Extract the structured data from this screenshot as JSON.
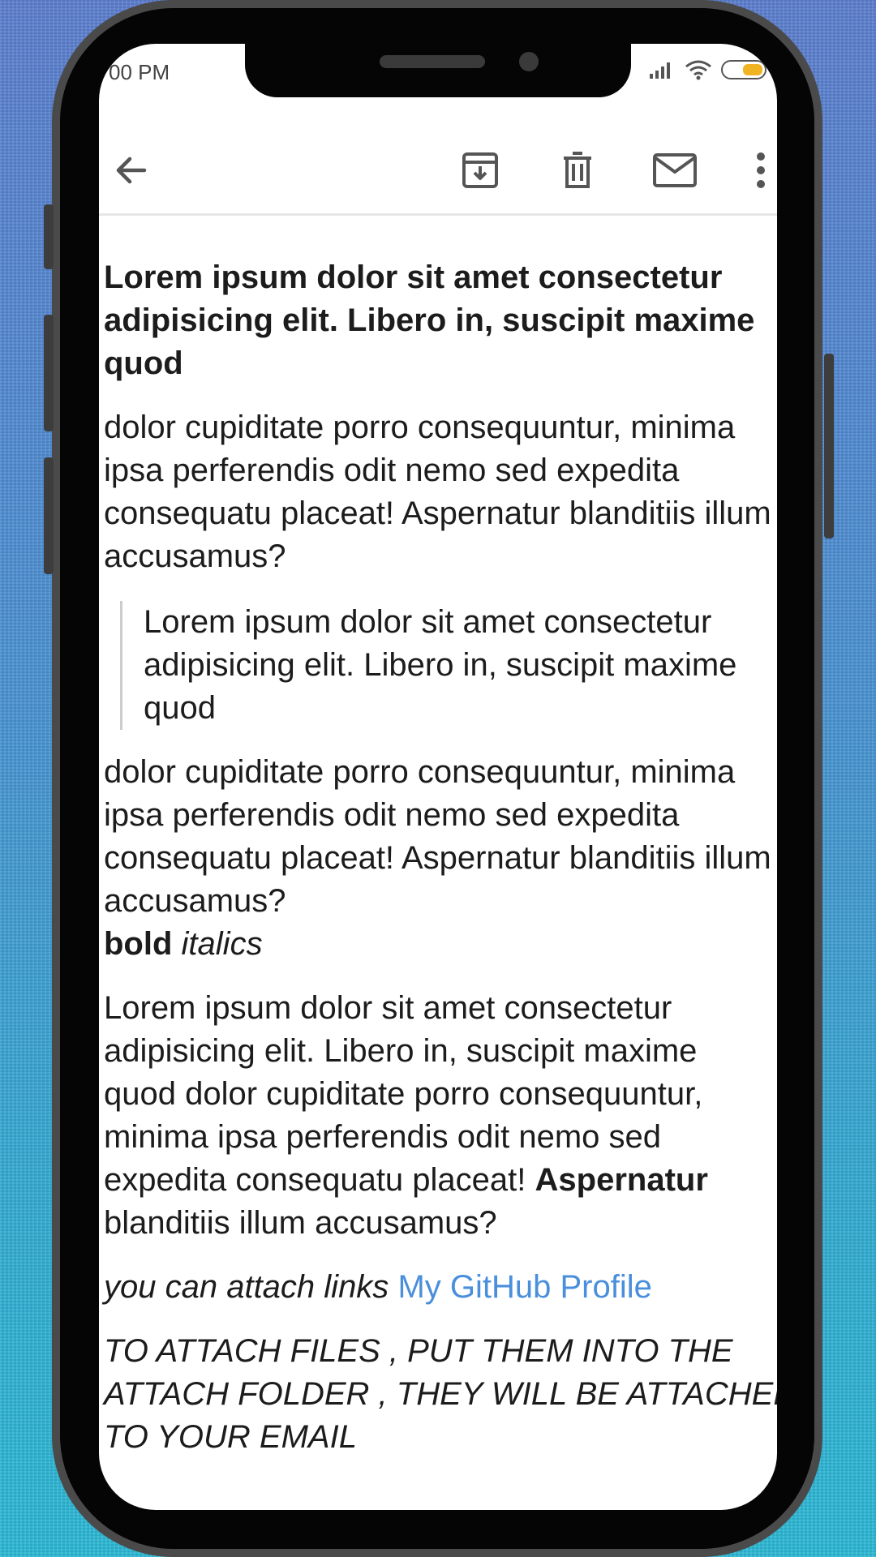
{
  "status_bar": {
    "time": "00 PM",
    "battery_percent": "4"
  },
  "toolbar": {
    "back_icon": "arrow-left-icon",
    "archive_icon": "archive-icon",
    "delete_icon": "trash-icon",
    "mark_unread_icon": "mail-icon",
    "more_icon": "more-vertical-icon"
  },
  "email": {
    "subject": "Lorem ipsum dolor sit amet consectetur adipisicing elit. Libero in, suscipit maxime quod",
    "paragraph1": "dolor cupiditate porro consequuntur, minima ipsa perferendis odit nemo sed expedita consequatu placeat! Aspernatur blanditiis illum accusamus?",
    "blockquote": "Lorem ipsum dolor sit amet consectetur adipisicing elit. Libero in, suscipit maxime quod",
    "paragraph2": "dolor cupiditate porro consequuntur, minima ipsa perferendis odit nemo sed expedita consequatu placeat! Aspernatur blanditiis illum accusamus?",
    "bold_sample": "bold",
    "italic_sample": "italics",
    "paragraph3_start": "Lorem ipsum dolor sit amet consectetur adipisicing elit. Libero in, suscipit maxime quod dolor cupiditate porro consequuntur, minima ipsa perferendis odit nemo sed expedita consequatu placeat!",
    "paragraph3_bold": "Aspernatur",
    "paragraph3_end": "blanditiis illum accusamus?",
    "links_intro": "you can attach links",
    "link_text": "My GitHub Profile",
    "attach_line1": "TO ATTACH FILES , PUT THEM INTO THE",
    "attach_line2": "ATTACH FOLDER , THEY WILL BE ATTACHED",
    "attach_line3": "TO YOUR EMAIL"
  }
}
